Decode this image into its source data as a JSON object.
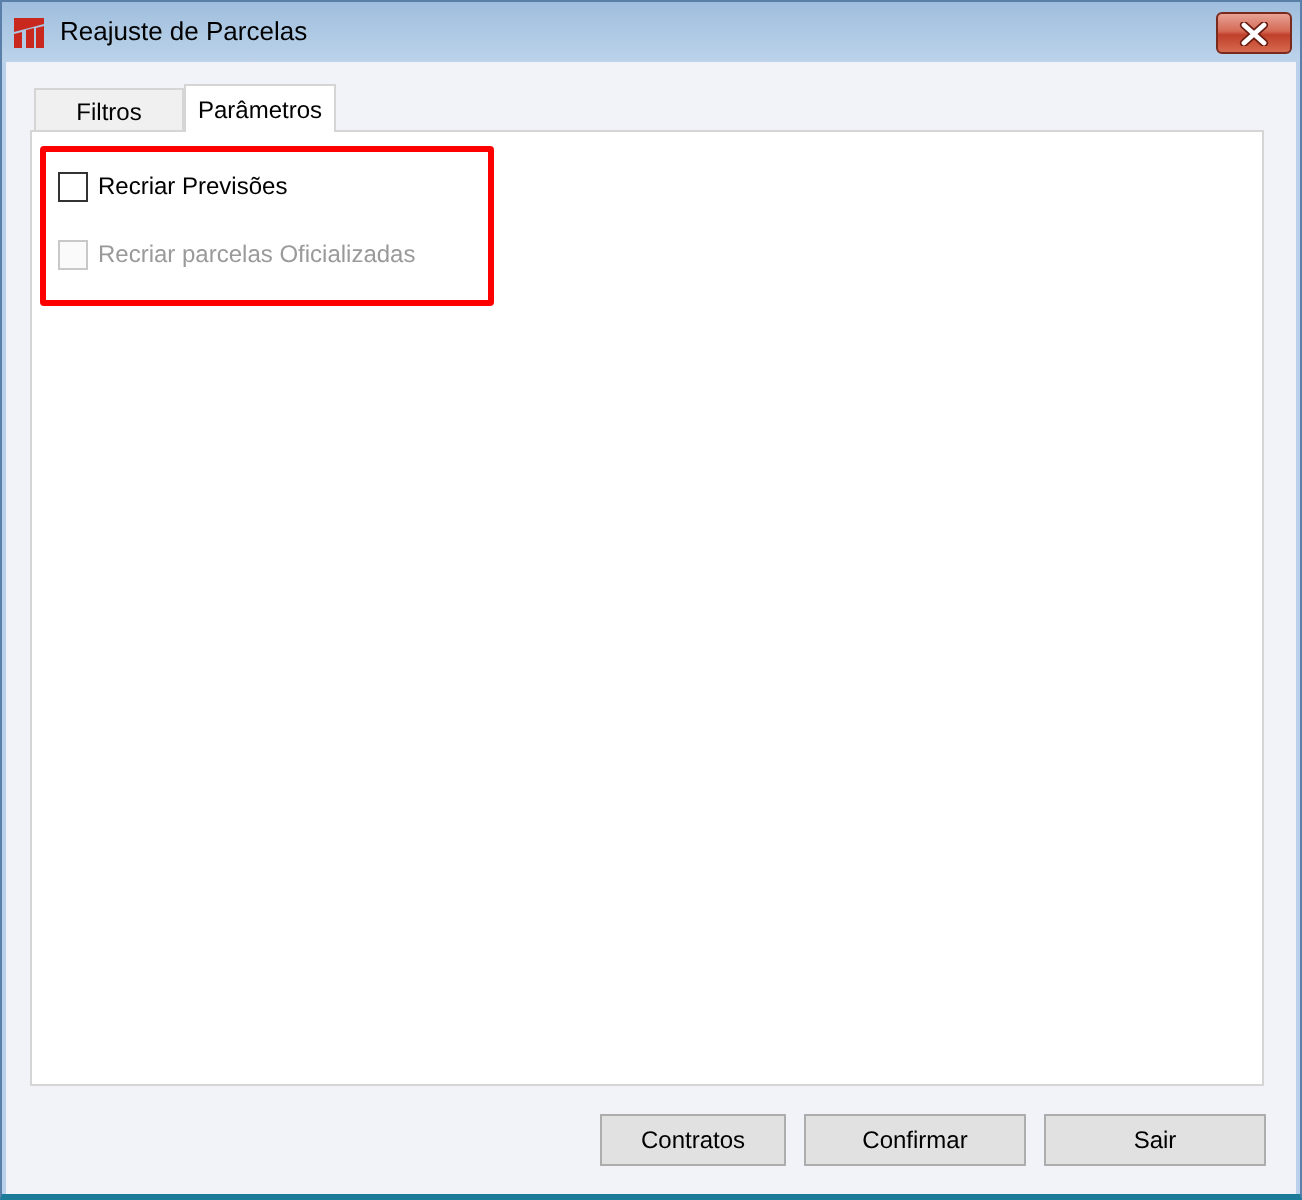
{
  "window": {
    "title": "Reajuste de Parcelas"
  },
  "tabs": [
    {
      "label": "Filtros",
      "selected": false
    },
    {
      "label": "Parâmetros",
      "selected": true
    }
  ],
  "options_group": {
    "highlighted": true
  },
  "options": [
    {
      "label": "Recriar Previsões",
      "checked": false,
      "disabled": false
    },
    {
      "label": "Recriar parcelas Oficializadas",
      "checked": false,
      "disabled": true
    }
  ],
  "buttons": [
    {
      "label": "Contratos"
    },
    {
      "label": "Confirmar"
    },
    {
      "label": "Sair"
    }
  ]
}
